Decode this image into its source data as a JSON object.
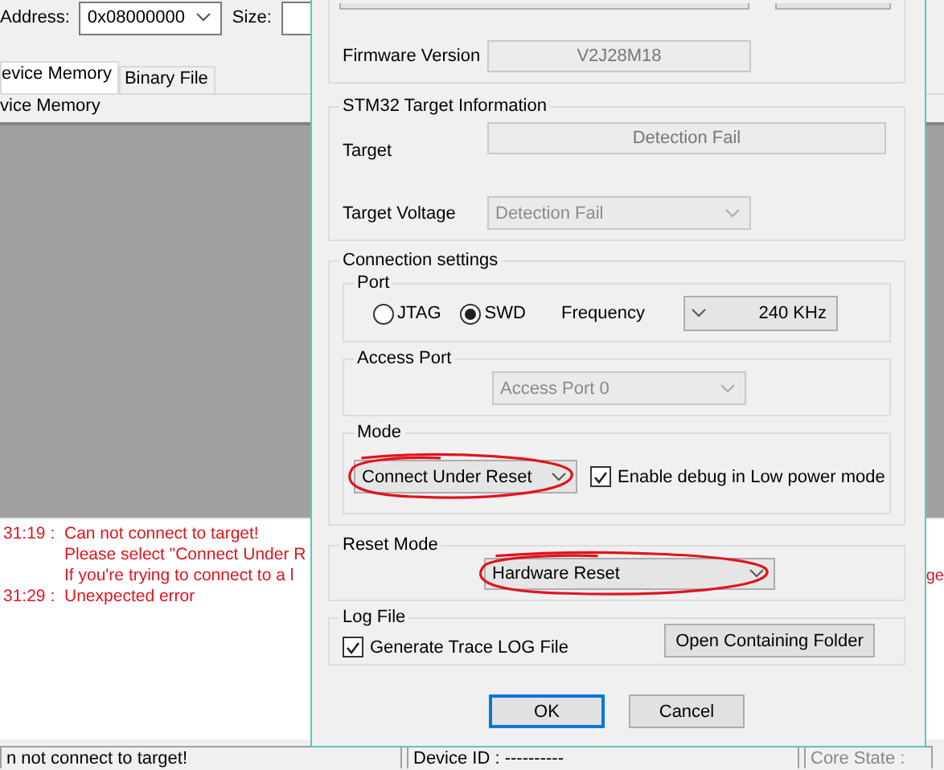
{
  "main_window": {
    "toolbar": {
      "address_label": "Address:",
      "address_value": "0x08000000",
      "size_label": "Size:"
    },
    "tabs": [
      {
        "label": "evice Memory",
        "selected": true
      },
      {
        "label": "Binary File",
        "selected": false
      }
    ],
    "memory_header": "vice Memory",
    "log_lines": [
      {
        "kind": "entry",
        "time": "31:19 :",
        "message": "Can not connect to target!"
      },
      {
        "kind": "continuation",
        "message": "Please select \"Connect Under R"
      },
      {
        "kind": "continuation",
        "message": "If you're trying to connect to a l",
        "tail": "ge"
      },
      {
        "kind": "entry",
        "time": "31:29 :",
        "message": "Unexpected error"
      }
    ],
    "status_bar": [
      "n not connect to target!",
      "Device ID : ----------",
      "Core State :"
    ]
  },
  "dialog": {
    "firmware": {
      "label": "Firmware Version",
      "value": "V2J28M18"
    },
    "target_info": {
      "title": "STM32 Target Information",
      "target": {
        "label": "Target",
        "value": "Detection Fail"
      },
      "voltage": {
        "label": "Target Voltage",
        "value": "Detection Fail",
        "disabled": true
      }
    },
    "connection": {
      "title": "Connection settings",
      "port": {
        "title": "Port",
        "options": [
          {
            "label": "JTAG",
            "selected": false
          },
          {
            "label": "SWD",
            "selected": true
          }
        ],
        "frequency_label": "Frequency",
        "frequency": "240 KHz"
      },
      "access_port": {
        "title": "Access Port",
        "value": "Access Port 0",
        "disabled": true
      },
      "mode": {
        "title": "Mode",
        "value": "Connect Under Reset",
        "annotated": true,
        "low_power": {
          "label": "Enable debug in Low power mode",
          "checked": true
        }
      }
    },
    "reset_mode": {
      "title": "Reset Mode",
      "value": "Hardware Reset",
      "annotated": true
    },
    "log_file": {
      "title": "Log File",
      "generate": {
        "label": "Generate Trace LOG File",
        "checked": true
      },
      "folder_button": "Open Containing Folder"
    },
    "buttons": [
      {
        "label": "OK",
        "default": true
      },
      {
        "label": "Cancel",
        "default": false
      }
    ]
  }
}
